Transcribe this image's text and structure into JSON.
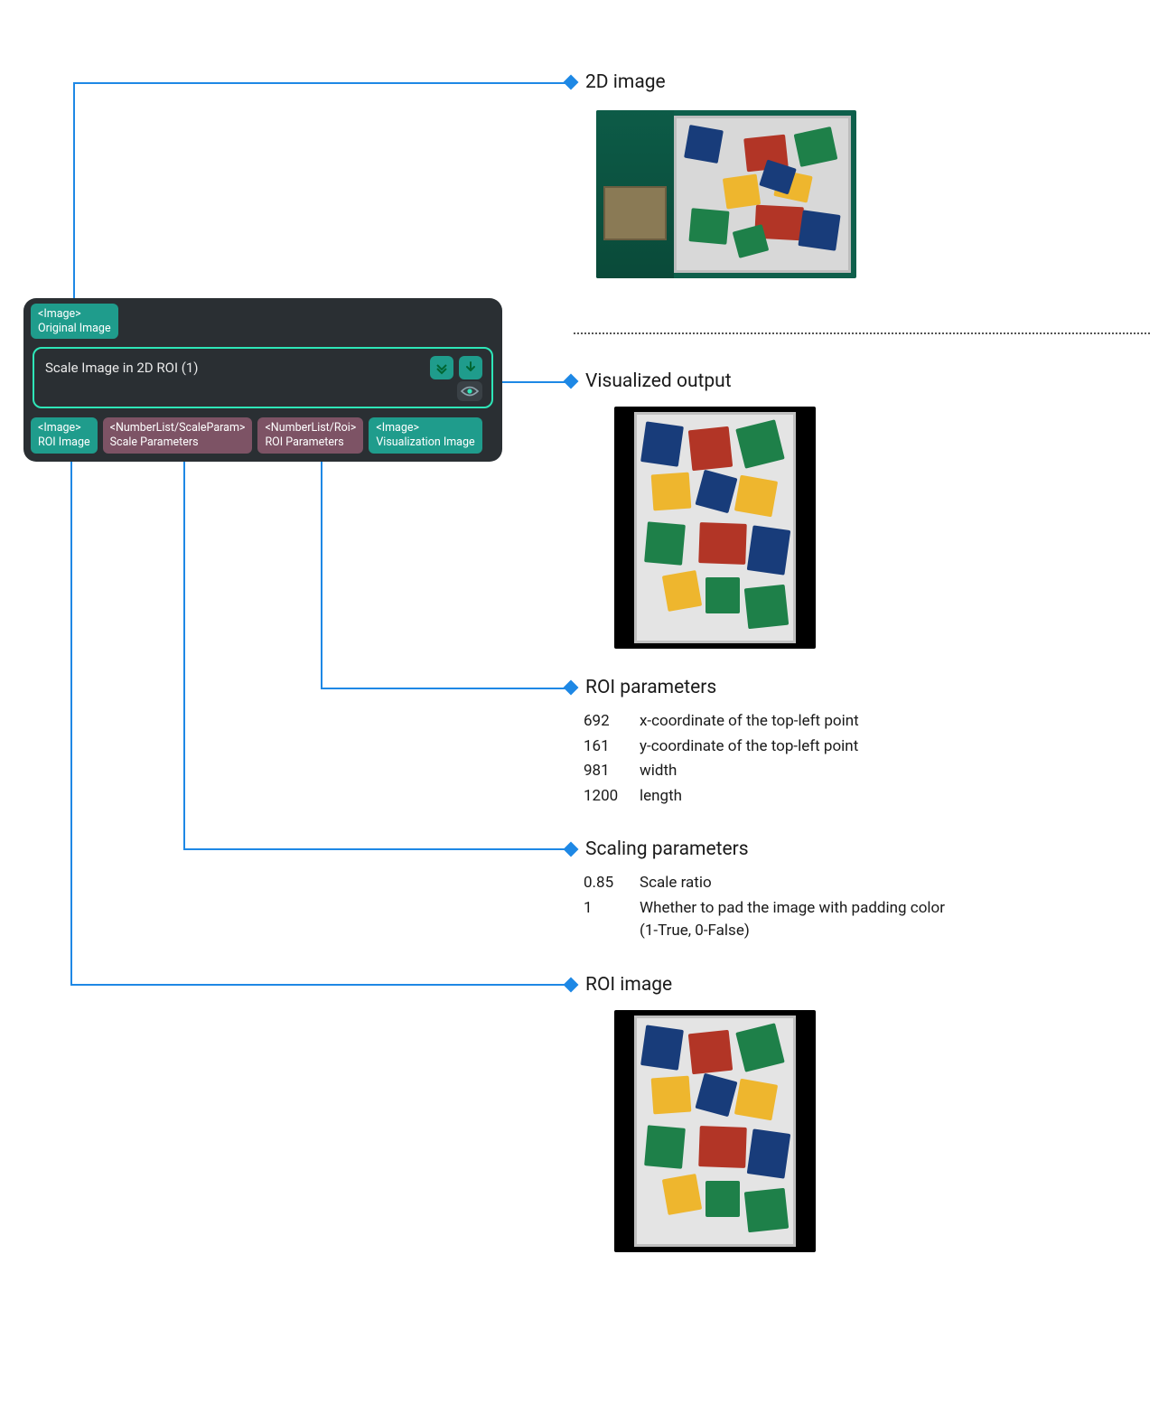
{
  "node": {
    "top_port": {
      "type": "<Image>",
      "label": "Original Image"
    },
    "title": "Scale Image in 2D ROI (1)",
    "bottom_ports": [
      {
        "type": "<Image>",
        "label": "ROI Image",
        "cls": "teal"
      },
      {
        "type": "<NumberList/ScaleParam>",
        "label": "Scale Parameters",
        "cls": "mauve"
      },
      {
        "type": "<NumberList/Roi>",
        "label": "ROI Parameters",
        "cls": "mauve"
      },
      {
        "type": "<Image>",
        "label": "Visualization Image",
        "cls": "teal"
      }
    ]
  },
  "callouts": {
    "image2d": {
      "title": "2D image"
    },
    "visout": {
      "title": "Visualized output"
    },
    "roiparams": {
      "title": "ROI parameters",
      "rows": [
        {
          "v": "692",
          "d": "x-coordinate of the top-left point"
        },
        {
          "v": "161",
          "d": "y-coordinate of the top-left point"
        },
        {
          "v": "981",
          "d": "width"
        },
        {
          "v": "1200",
          "d": "length"
        }
      ]
    },
    "scaleparams": {
      "title": "Scaling parameters",
      "rows": [
        {
          "v": "0.85",
          "d": "Scale ratio"
        },
        {
          "v": "1",
          "d": "Whether to pad the image with padding color (1-True, 0-False)"
        }
      ]
    },
    "roiimage": {
      "title": "ROI image"
    }
  }
}
